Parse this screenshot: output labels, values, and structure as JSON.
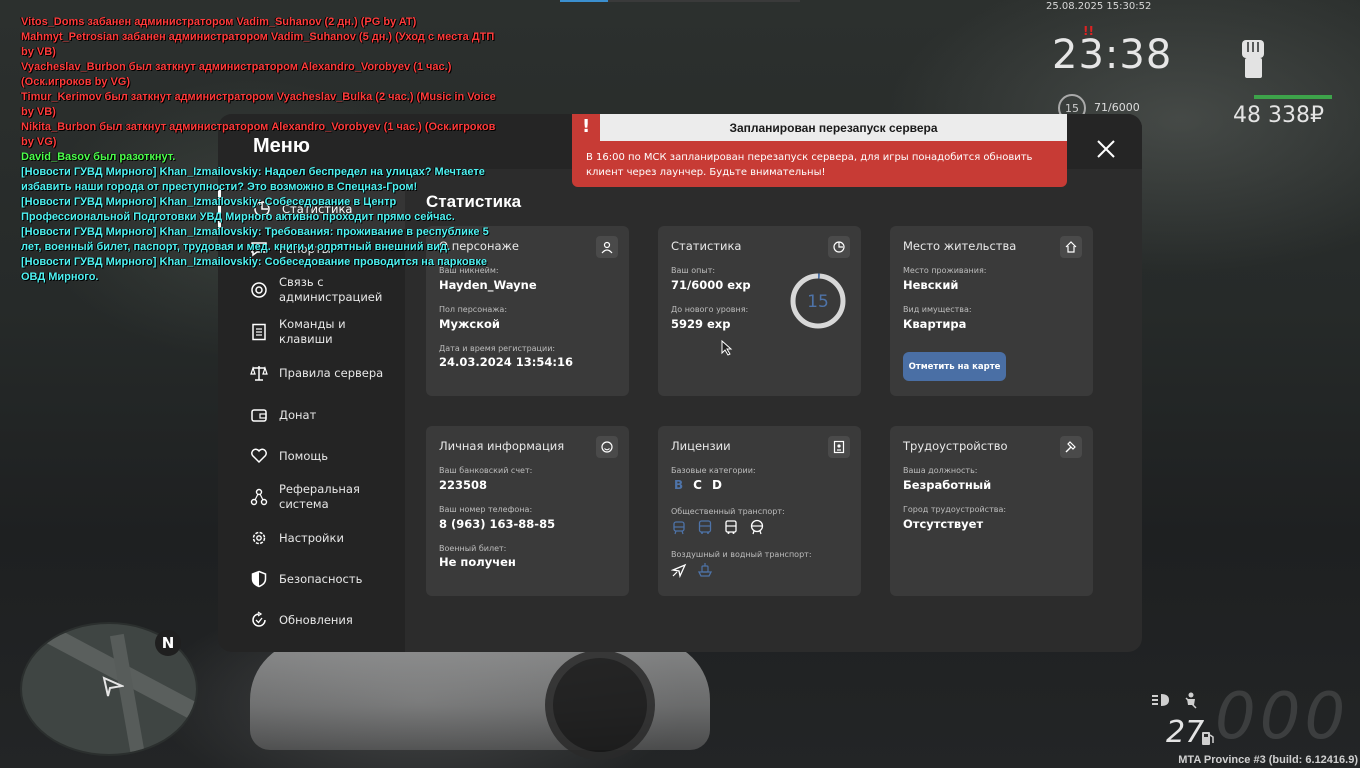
{
  "hud": {
    "date": "25.08.2025 15:30:52",
    "time": "23:38",
    "wanted_mark": "!!",
    "level": "15",
    "exp": "71/6000",
    "money": "48 338₽",
    "speed": "27",
    "speed_ghost": "000",
    "build": "MTA Province #3 (build: 6.12416.9)",
    "minimap_north": "N"
  },
  "notification": {
    "title": "Запланирован перезапуск сервера",
    "bang": "!",
    "body": "В 16:00 по МСК запланирован перезапуск сервера, для игры понадобится обновить клиент через лаунчер. Будьте внимательны!"
  },
  "menu": {
    "title": "Меню",
    "content_title": "Статистика",
    "nav": [
      {
        "id": "stats",
        "label": "Статистика",
        "icon": "stats-icon"
      },
      {
        "id": "reports",
        "label": "Репорты",
        "icon": "chat-icon"
      },
      {
        "id": "admin",
        "label": "Связь с администрацией",
        "icon": "support-icon"
      },
      {
        "id": "commands",
        "label": "Команды и клавиши",
        "icon": "document-icon"
      },
      {
        "id": "rules",
        "label": "Правила сервера",
        "icon": "scales-icon"
      },
      {
        "id": "donate",
        "label": "Донат",
        "icon": "wallet-icon"
      },
      {
        "id": "help",
        "label": "Помощь",
        "icon": "heart-handshake-icon"
      },
      {
        "id": "referral",
        "label": "Реферальная система",
        "icon": "referral-icon"
      },
      {
        "id": "settings",
        "label": "Настройки",
        "icon": "gear-icon"
      },
      {
        "id": "security",
        "label": "Безопасность",
        "icon": "shield-icon"
      },
      {
        "id": "updates",
        "label": "Обновления",
        "icon": "refresh-icon"
      }
    ],
    "cards": {
      "character": {
        "title": "О персонаже",
        "nickname_label": "Ваш никнейм:",
        "nickname": "Hayden_Wayne",
        "gender_label": "Пол персонажа:",
        "gender": "Мужской",
        "reg_label": "Дата и время регистрации:",
        "reg": "24.03.2024 13:54:16"
      },
      "stats": {
        "title": "Статистика",
        "exp_label": "Ваш опыт:",
        "exp": "71/6000 exp",
        "next_label": "До нового уровня:",
        "next": "5929 exp",
        "level": "15",
        "progress": 0.0118
      },
      "residence": {
        "title": "Место жительства",
        "place_label": "Место проживания:",
        "place": "Невский",
        "property_label": "Вид имущества:",
        "property": "Квартира",
        "map_button": "Отметить на карте"
      },
      "personal": {
        "title": "Личная информация",
        "bank_label": "Ваш банковский счет:",
        "bank": "223508",
        "phone_label": "Ваш номер телефона:",
        "phone": "8 (963) 163-88-85",
        "military_label": "Военный билет:",
        "military": "Не получен"
      },
      "licenses": {
        "title": "Лицензии",
        "basic_label": "Базовые категории:",
        "categories": [
          "B",
          "C",
          "D"
        ],
        "public_label": "Общественный транспорт:",
        "air_label": "Воздушный и водный транспорт:"
      },
      "employment": {
        "title": "Трудоустройство",
        "position_label": "Ваша должность:",
        "position": "Безработный",
        "city_label": "Город трудоустройства:",
        "city": "Отсутствует"
      }
    }
  },
  "chat": [
    {
      "color": "#ff3b3b",
      "text": "Vitos_Doms забанен администратором Vadim_Suhanov (2 дн.) (PG by AT)"
    },
    {
      "color": "#ff3b3b",
      "text": "Mahmyt_Petrosian забанен администратором Vadim_Suhanov (5 дн.) (Уход с места ДТП by VB)"
    },
    {
      "color": "#ff3b3b",
      "text": "Vyacheslav_Burbon был заткнут администратором Alexandro_Vorobyev (1 час.) (Оск.игроков by VG)"
    },
    {
      "color": "#ff3b3b",
      "text": "Timur_Kerimov был заткнут администратором Vyacheslav_Bulka (2 час.) (Music in Voice by VB)"
    },
    {
      "color": "#ff3b3b",
      "text": "Nikita_Burbon был заткнут администратором Alexandro_Vorobyev (1 час.) (Оск.игроков by VG)"
    },
    {
      "color": "#4cff4c",
      "text": "David_Basov был разоткнут."
    },
    {
      "color": "#4ff2f2",
      "text": "[Новости ГУВД Мирного] Khan_Izmailovskiy: Надоел беспредел на улицах? Мечтаете избавить наши города от преступности? Это возможно в Спецназ-Гром!"
    },
    {
      "color": "#4ff2f2",
      "text": "[Новости ГУВД Мирного] Khan_Izmailovskiy: Собеседование в Центр Профессиональной Подготовки УВД Мирного активно проходит прямо сейчас."
    },
    {
      "color": "#4ff2f2",
      "text": "[Новости ГУВД Мирного] Khan_Izmailovskiy: Требования: проживание в республике 5 лет, военный билет, паспорт, трудовая и мед. книги и опрятный внешний вид."
    },
    {
      "color": "#4ff2f2",
      "text": "[Новости ГУВД Мирного] Khan_Izmailovskiy: Собеседование проводится на парковке ОВД Мирного."
    }
  ]
}
